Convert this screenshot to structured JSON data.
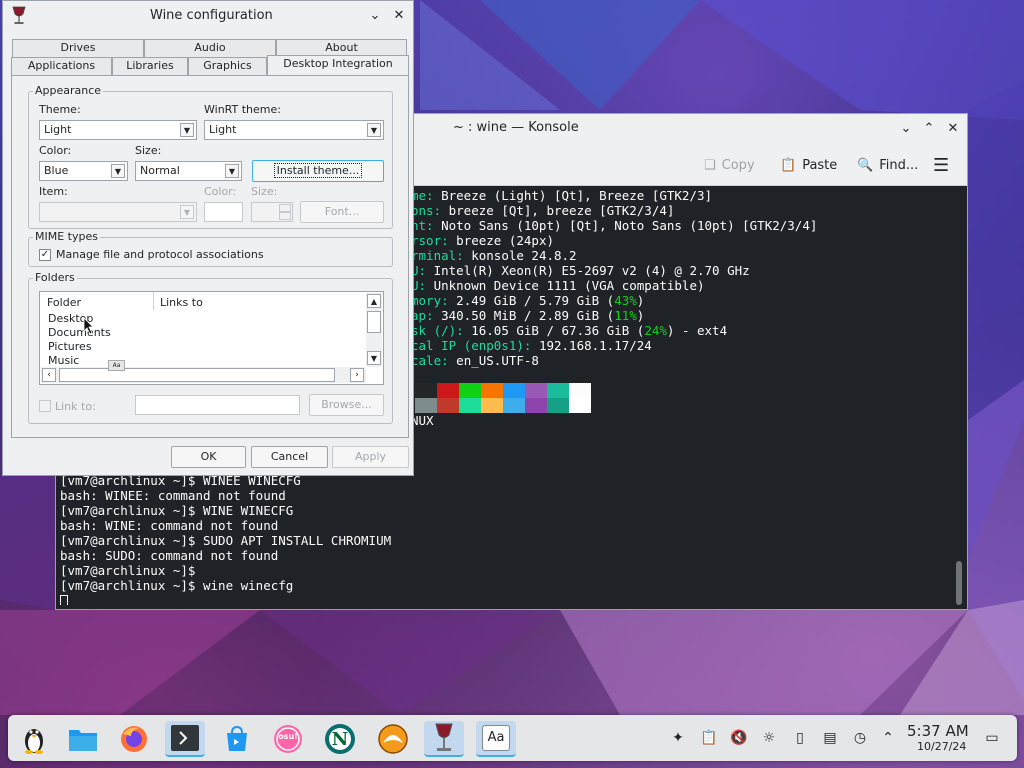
{
  "konsole": {
    "title": "~ : wine — Konsole",
    "toolbar": {
      "copy": "Copy",
      "paste": "Paste",
      "find": "Find..."
    },
    "fetch_lines": [
      {
        "key": "me:",
        "value": " Breeze (Light) [Qt], Breeze [GTK2/3]"
      },
      {
        "key": "ons:",
        "value": " breeze [Qt], breeze [GTK2/3/4]"
      },
      {
        "key": "nt:",
        "value": " Noto Sans (10pt) [Qt], Noto Sans (10pt) [GTK2/3/4]"
      },
      {
        "key": "rsor:",
        "value": " breeze (24px)"
      },
      {
        "key": "rminal:",
        "value": " konsole 24.8.2"
      },
      {
        "key": "U:",
        "value": " Intel(R) Xeon(R) E5-2697 v2 (4) @ 2.70 GHz"
      },
      {
        "key": "U:",
        "value": " Unknown Device 1111 (VGA compatible)"
      },
      {
        "key": "mory:",
        "value": " 2.49 GiB / 5.79 GiB (",
        "pct": "43%",
        "tail": ")"
      },
      {
        "key": "ap:",
        "value": " 340.50 MiB / 2.89 GiB (",
        "pct": "11%",
        "tail": ")"
      },
      {
        "key": "sk (/):",
        "value": " 16.05 GiB / 67.36 GiB (",
        "pct": "24%",
        "tail": ") - ext4"
      },
      {
        "key": "cal IP (enp0s1):",
        "value": " 192.168.1.17/24"
      },
      {
        "key": "cale:",
        "value": " en_US.UTF-8"
      }
    ],
    "os_fragment": "NUX",
    "history": [
      "[vm7@archlinux ~]$ WINEE WINECFG",
      "bash: WINEE: command not found",
      "[vm7@archlinux ~]$ WINE WINECFG",
      "bash: WINE: command not found",
      "[vm7@archlinux ~]$ SUDO APT INSTALL CHROMIUM",
      "bash: SUDO: command not found",
      "[vm7@archlinux ~]$",
      "[vm7@archlinux ~]$ wine winecfg"
    ],
    "palette_top": [
      "#232627",
      "#cc1818",
      "#11d116",
      "#f67400",
      "#1d99f3",
      "#9b59b6",
      "#1abc9c",
      "#fcfcfc"
    ],
    "palette_bottom": [
      "#7f8c8d",
      "#c0392b",
      "#1cdc9a",
      "#fdbc4b",
      "#3daee9",
      "#8e44ad",
      "#16a085",
      "#ffffff"
    ]
  },
  "wine": {
    "title": "Wine configuration",
    "tabs_row1": [
      "Drives",
      "Audio",
      "About"
    ],
    "tabs_row2": [
      "Applications",
      "Libraries",
      "Graphics",
      "Desktop Integration"
    ],
    "appearance": {
      "label": "Appearance",
      "theme_label": "Theme:",
      "theme_value": "Light",
      "winrt_label": "WinRT theme:",
      "winrt_value": "Light",
      "color_label": "Color:",
      "color_value": "Blue",
      "size_label": "Size:",
      "size_value": "Normal",
      "install_theme": "Install theme...",
      "item_label": "Item:",
      "item_color_label": "Color:",
      "item_size_label": "Size:",
      "font_button": "Font..."
    },
    "mime": {
      "label": "MIME types",
      "manage": "Manage file and protocol associations"
    },
    "folders": {
      "label": "Folders",
      "col_folder": "Folder",
      "col_links": "Links to",
      "items": [
        "Desktop",
        "Documents",
        "Pictures",
        "Music"
      ],
      "link_to": "Link to:",
      "browse": "Browse..."
    },
    "buttons": {
      "ok": "OK",
      "cancel": "Cancel",
      "apply": "Apply"
    }
  },
  "taskbar": {
    "time": "5:37 AM",
    "date": "10/27/24",
    "apps": [
      "application-launcher",
      "file-manager",
      "firefox",
      "konsole",
      "discover",
      "osu",
      "netscape",
      "wine-app",
      "wine-config",
      "font-viewer"
    ],
    "osu_label": "osu!",
    "netscape_letter": "N",
    "font_viewer_label": "Aa"
  }
}
